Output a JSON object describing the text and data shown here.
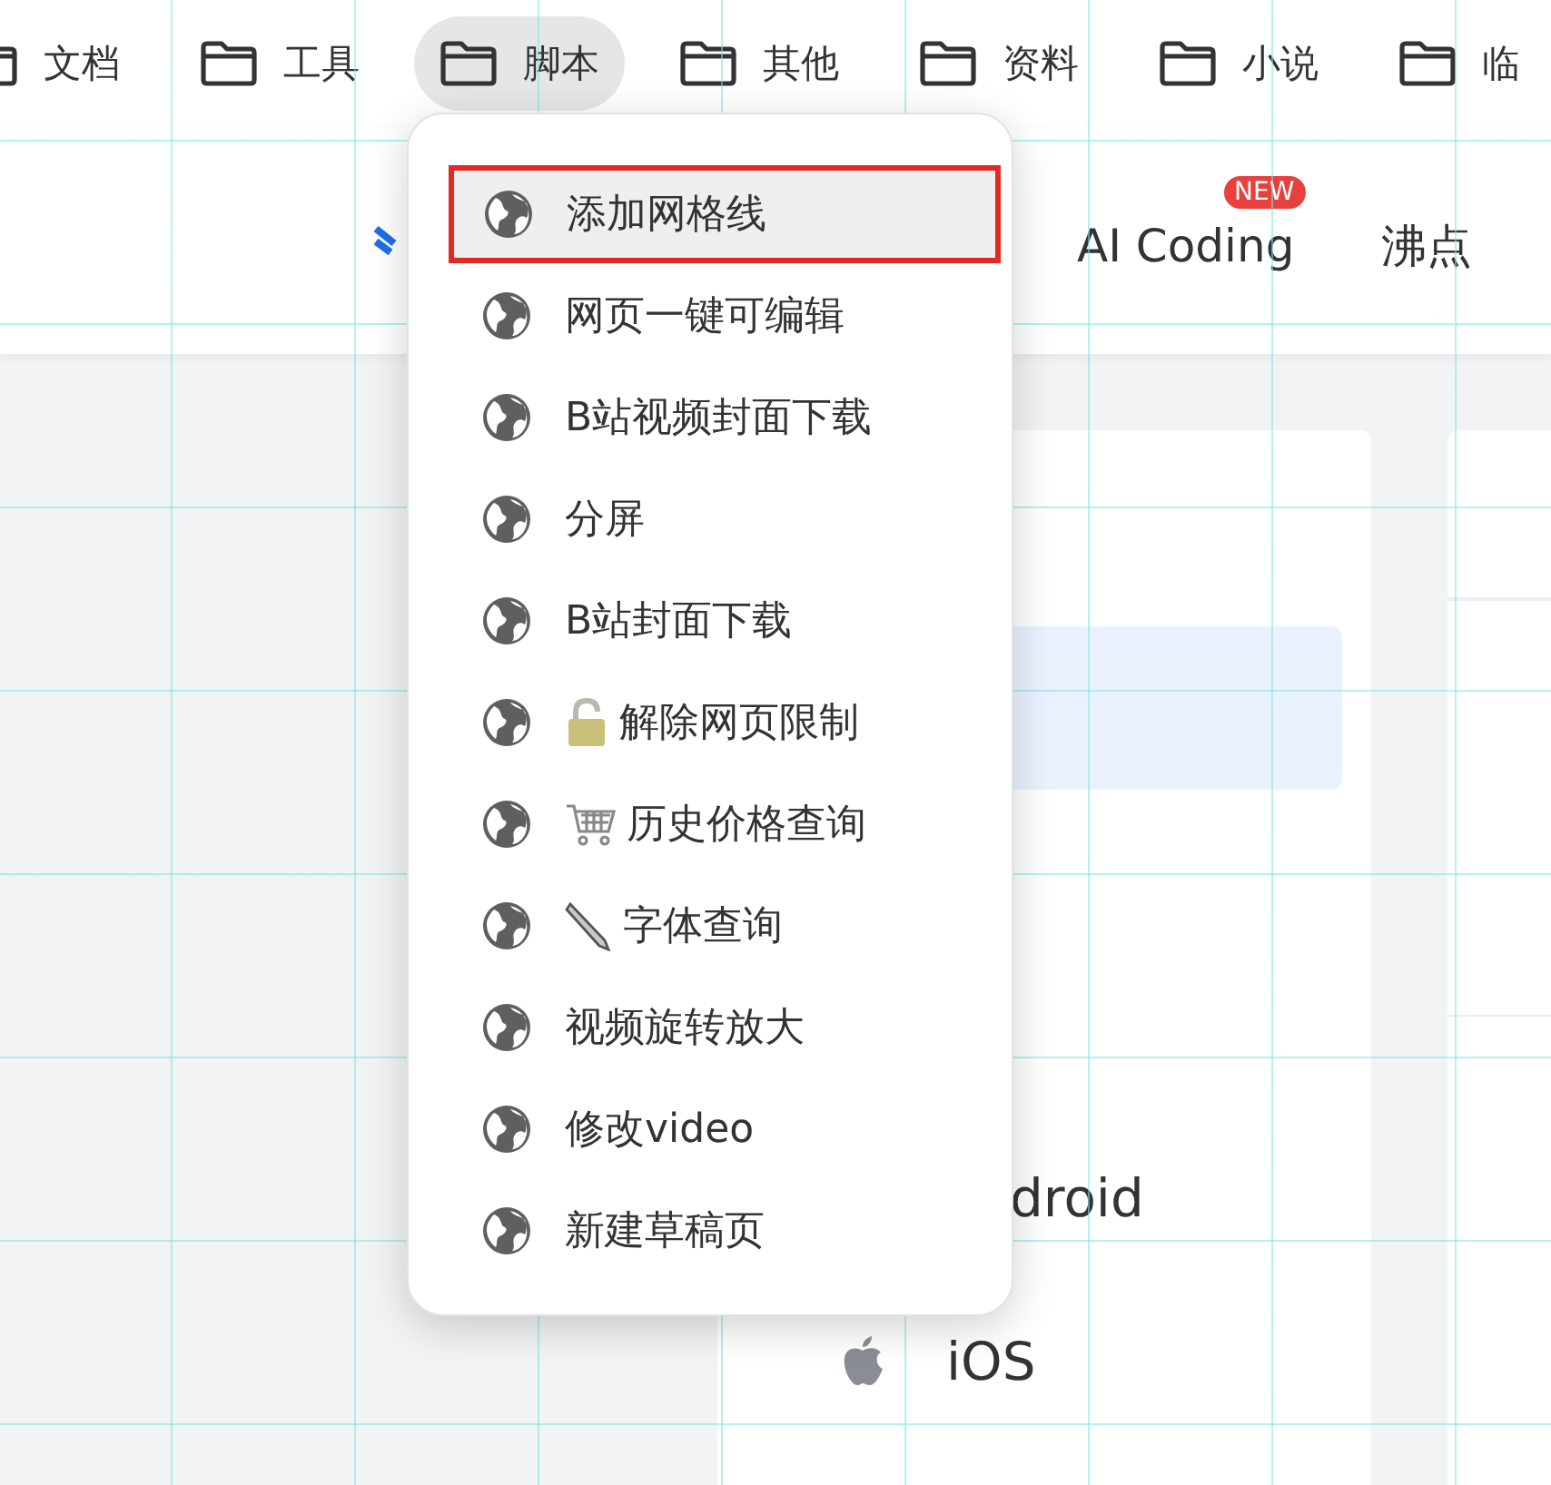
{
  "bookmarks": [
    {
      "label": "文档",
      "selected": false
    },
    {
      "label": "工具",
      "selected": false
    },
    {
      "label": "脚本",
      "selected": true
    },
    {
      "label": "其他",
      "selected": false
    },
    {
      "label": "资料",
      "selected": false
    },
    {
      "label": "小说",
      "selected": false
    },
    {
      "label": "临",
      "selected": false
    }
  ],
  "header": {
    "nav": [
      {
        "label": "AI Coding",
        "badge": "NEW"
      },
      {
        "label": "沸点"
      }
    ]
  },
  "side_nav": [
    {
      "selected": false
    },
    {
      "selected": true
    },
    {
      "selected": false
    },
    {
      "selected": false
    },
    {
      "label": "droid",
      "selected": false,
      "kind": "text"
    },
    {
      "label": "iOS",
      "selected": false,
      "kind": "apple"
    }
  ],
  "menu": {
    "items": [
      {
        "label": "添加网格线",
        "selected": true,
        "kind": "plain"
      },
      {
        "label": "网页一键可编辑",
        "selected": false,
        "kind": "plain"
      },
      {
        "label": "B站视频封面下载",
        "selected": false,
        "kind": "plain"
      },
      {
        "label": "分屏",
        "selected": false,
        "kind": "plain"
      },
      {
        "label": "B站封面下载",
        "selected": false,
        "kind": "plain"
      },
      {
        "label": "解除网页限制",
        "selected": false,
        "kind": "lock"
      },
      {
        "label": "历史价格查询",
        "selected": false,
        "kind": "cart"
      },
      {
        "label": "字体查询",
        "selected": false,
        "kind": "pen"
      },
      {
        "label": "视频旋转放大",
        "selected": false,
        "kind": "plain"
      },
      {
        "label": "修改video",
        "selected": false,
        "kind": "plain"
      },
      {
        "label": "新建草稿页",
        "selected": false,
        "kind": "plain"
      }
    ]
  }
}
